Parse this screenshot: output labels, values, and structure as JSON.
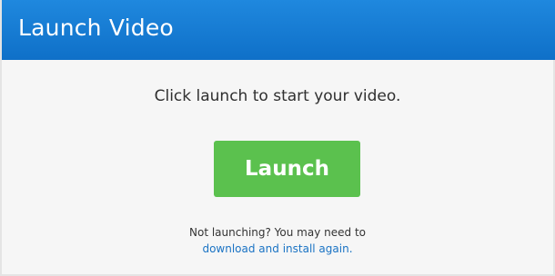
{
  "dialog": {
    "title": "Launch Video",
    "instruction": "Click launch to start your video.",
    "launch_label": "Launch",
    "help_text": "Not launching? You may need to",
    "help_link": "download and install again."
  },
  "colors": {
    "header": "#1780d6",
    "button": "#5bc14e",
    "link": "#1a73c4",
    "background": "#f6f6f6"
  }
}
